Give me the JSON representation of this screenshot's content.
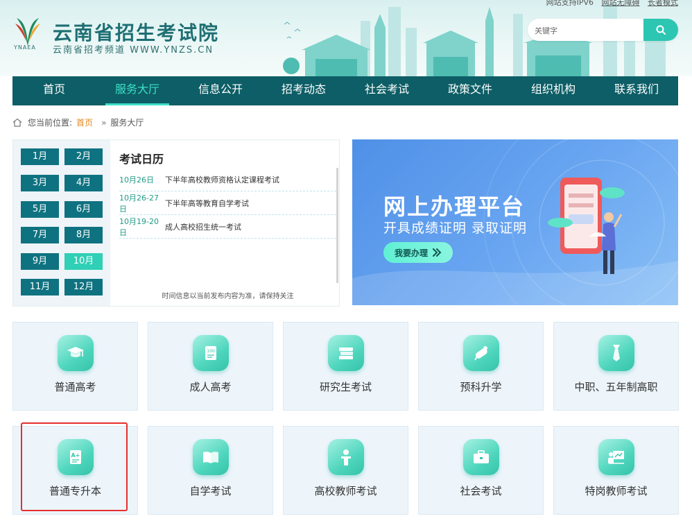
{
  "header": {
    "site_title": "云南省招生考试院",
    "site_subtitle": "云南省招考频道 WWW.YNZS.CN",
    "logo_abbr": "YNAEA",
    "top_links": {
      "ipv6": "网站支持IPV6",
      "accessible": "网站无障碍",
      "elder_mode": "长者模式"
    },
    "search": {
      "placeholder": "关键字",
      "icon": "search-icon"
    }
  },
  "nav": {
    "items": [
      "首页",
      "服务大厅",
      "信息公开",
      "招考动态",
      "社会考试",
      "政策文件",
      "组织机构",
      "联系我们"
    ],
    "active_index": 1
  },
  "breadcrumb": {
    "prefix": "您当前位置:",
    "home": "首页",
    "separator": "»",
    "current": "服务大厅"
  },
  "calendar": {
    "title": "考试日历",
    "months": [
      "1月",
      "2月",
      "3月",
      "4月",
      "5月",
      "6月",
      "7月",
      "8月",
      "9月",
      "10月",
      "11月",
      "12月"
    ],
    "active_month": "10月",
    "events": [
      {
        "date": "10月26日",
        "text": "下半年高校教师资格认定课程考试"
      },
      {
        "date": "10月26-27日",
        "text": "下半年高等教育自学考试"
      },
      {
        "date": "10月19-20日",
        "text": "成人高校招生统一考试"
      }
    ],
    "note": "时间信息以当前发布内容为准，请保持关注"
  },
  "banner": {
    "title": "网上办理平台",
    "subtitle": "开具成绩证明 录取证明",
    "button": "我要办理",
    "button_icon": "double-chevron-right-icon"
  },
  "tiles": [
    {
      "label": "普通高考",
      "icon": "graduation-cap-icon"
    },
    {
      "label": "成人高考",
      "icon": "certificate-scroll-icon"
    },
    {
      "label": "研究生考试",
      "icon": "book-stack-icon"
    },
    {
      "label": "预科升学",
      "icon": "diploma-roll-icon"
    },
    {
      "label": "中职、五年制高职",
      "icon": "necktie-icon"
    },
    {
      "label": "普通专升本",
      "icon": "grade-document-icon"
    },
    {
      "label": "自学考试",
      "icon": "open-book-icon"
    },
    {
      "label": "高校教师考试",
      "icon": "teacher-icon"
    },
    {
      "label": "社会考试",
      "icon": "briefcase-icon"
    },
    {
      "label": "特岗教师考试",
      "icon": "teacher-board-icon"
    }
  ],
  "colors": {
    "nav_bg": "#0d5e66",
    "nav_active": "#3ee0c9",
    "month_btn": "#0f7280",
    "month_active": "#2fd0b5",
    "accent": "#2cc6b3",
    "highlight": "#e62e2e"
  }
}
